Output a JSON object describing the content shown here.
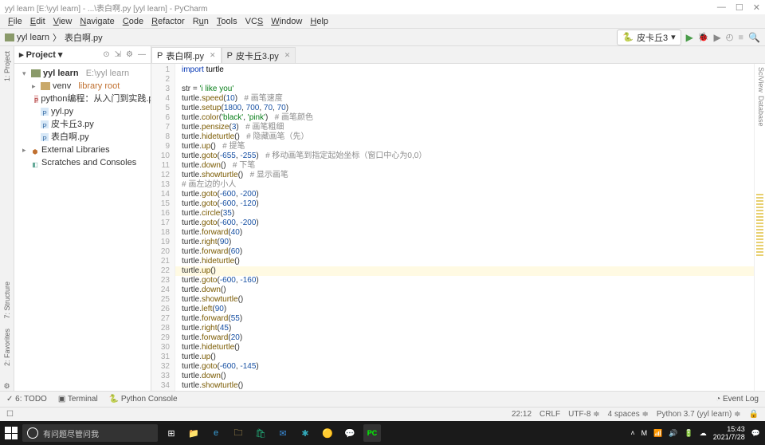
{
  "title": "yyl learn [E:\\yyl learn] - ...\\表白啊.py [yyl learn] - PyCharm",
  "menu": [
    "File",
    "Edit",
    "View",
    "Navigate",
    "Code",
    "Refactor",
    "Run",
    "Tools",
    "VCS",
    "Window",
    "Help"
  ],
  "breadcrumbs": {
    "root": "yyl learn",
    "file": "表白啊.py"
  },
  "runcfg": "皮卡丘3",
  "project_panel_title": "Project",
  "tree": {
    "root": {
      "name": "yyl learn",
      "path": "E:\\yyl learn"
    },
    "venv": "venv",
    "venv_note": "library root",
    "pdf": "python编程：从入门到实践.pdf",
    "py1": "yyl.py",
    "py2": "皮卡丘3.py",
    "py3": "表白啊.py",
    "ext": "External Libraries",
    "scr": "Scratches and Consoles"
  },
  "tabs": [
    {
      "label": "表白啊.py",
      "active": true
    },
    {
      "label": "皮卡丘3.py",
      "active": false
    }
  ],
  "code_lines": [
    {
      "n": 1,
      "h": "<span class='im'>import</span> <span class='mod'>turtle</span>"
    },
    {
      "n": 2,
      "h": ""
    },
    {
      "n": 3,
      "h": "str = <span class='str'>'i like you'</span>"
    },
    {
      "n": 4,
      "h": "turtle.<span class='fn'>speed</span>(<span class='num'>10</span>)   <span class='cmt'># 画笔速度</span>"
    },
    {
      "n": 5,
      "h": "turtle.<span class='fn'>setup</span>(<span class='num'>1800</span>, <span class='num'>700</span>, <span class='num'>70</span>, <span class='num'>70</span>)"
    },
    {
      "n": 6,
      "h": "turtle.<span class='fn'>color</span>(<span class='str'>'black'</span>, <span class='str'>'pink'</span>)   <span class='cmt'># 画笔颜色</span>"
    },
    {
      "n": 7,
      "h": "turtle.<span class='fn'>pensize</span>(<span class='num'>3</span>)   <span class='cmt'># 画笔粗细</span>"
    },
    {
      "n": 8,
      "h": "turtle.<span class='fn'>hideturtle</span>()   <span class='cmt'># 隐藏画笔（先）</span>"
    },
    {
      "n": 9,
      "h": "turtle.<span class='fn'>up</span>()   <span class='cmt'># 提笔</span>"
    },
    {
      "n": 10,
      "h": "turtle.<span class='fn'>goto</span>(<span class='num'>-655</span>, <span class='num'>-255</span>)   <span class='cmt'># 移动画笔到指定起始坐标（窗口中心为0,0）</span>"
    },
    {
      "n": 11,
      "h": "turtle.<span class='fn'>down</span>()   <span class='cmt'># 下笔</span>"
    },
    {
      "n": 12,
      "h": "turtle.<span class='fn'>showturtle</span>()   <span class='cmt'># 显示画笔</span>"
    },
    {
      "n": 13,
      "h": "<span class='cmt'># 画左边的小人</span>"
    },
    {
      "n": 14,
      "h": "turtle.<span class='fn'>goto</span>(<span class='num'>-600</span>, <span class='num'>-200</span>)"
    },
    {
      "n": 15,
      "h": "turtle.<span class='fn'>goto</span>(<span class='num'>-600</span>, <span class='num'>-120</span>)"
    },
    {
      "n": 16,
      "h": "turtle.<span class='fn'>circle</span>(<span class='num'>35</span>)"
    },
    {
      "n": 17,
      "h": "turtle.<span class='fn'>goto</span>(<span class='num'>-600</span>, <span class='num'>-200</span>)"
    },
    {
      "n": 18,
      "h": "turtle.<span class='fn'>forward</span>(<span class='num'>40</span>)"
    },
    {
      "n": 19,
      "h": "turtle.<span class='fn'>right</span>(<span class='num'>90</span>)"
    },
    {
      "n": 20,
      "h": "turtle.<span class='fn'>forward</span>(<span class='num'>60</span>)"
    },
    {
      "n": 21,
      "h": "turtle.<span class='fn'>hideturtle</span>()"
    },
    {
      "n": 22,
      "h": "turtle.<span class='fn'>up</span>()",
      "hl": true
    },
    {
      "n": 23,
      "h": "turtle.<span class='fn'>goto</span>(<span class='num'>-600</span>, <span class='num'>-160</span>)"
    },
    {
      "n": 24,
      "h": "turtle.<span class='fn'>down</span>()"
    },
    {
      "n": 25,
      "h": "turtle.<span class='fn'>showturtle</span>()"
    },
    {
      "n": 26,
      "h": "turtle.<span class='fn'>left</span>(<span class='num'>90</span>)"
    },
    {
      "n": 27,
      "h": "turtle.<span class='fn'>forward</span>(<span class='num'>55</span>)"
    },
    {
      "n": 28,
      "h": "turtle.<span class='fn'>right</span>(<span class='num'>45</span>)"
    },
    {
      "n": 29,
      "h": "turtle.<span class='fn'>forward</span>(<span class='num'>20</span>)"
    },
    {
      "n": 30,
      "h": "turtle.<span class='fn'>hideturtle</span>()"
    },
    {
      "n": 31,
      "h": "turtle.<span class='fn'>up</span>()"
    },
    {
      "n": 32,
      "h": "turtle.<span class='fn'>goto</span>(<span class='num'>-600</span>, <span class='num'>-145</span>)"
    },
    {
      "n": 33,
      "h": "turtle.<span class='fn'>down</span>()"
    },
    {
      "n": 34,
      "h": "turtle.<span class='fn'>showturtle</span>()"
    }
  ],
  "bottom_tools": {
    "todo": "TODO",
    "todo_n": "6:",
    "terminal": "Terminal",
    "pyconsole": "Python Console",
    "eventlog": "Event Log"
  },
  "status": {
    "pos": "22:12",
    "crlf": "CRLF",
    "enc": "UTF-8",
    "spaces": "4 spaces",
    "interp": "Python 3.7 (yyl learn)"
  },
  "taskbar": {
    "search_placeholder": "有问题尽管问我",
    "time": "15:43",
    "date": "2021/7/28"
  },
  "siderail": {
    "proj": "1: Project",
    "struct": "7: Structure",
    "fav": "2: Favorites",
    "sci": "SciView",
    "db": "Database"
  }
}
